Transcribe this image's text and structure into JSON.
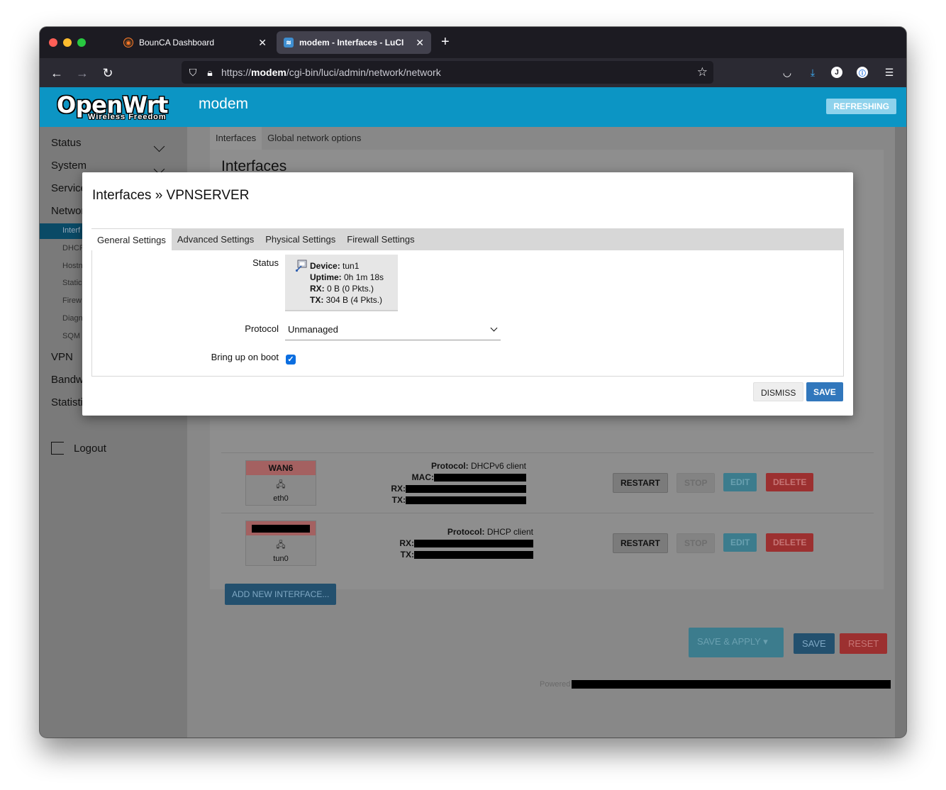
{
  "browser": {
    "tabs": [
      {
        "title": "BounCA Dashboard",
        "active": false
      },
      {
        "title": "modem - Interfaces - LuCI",
        "active": true
      }
    ],
    "url": {
      "scheme": "https://",
      "host": "modem",
      "path": "/cgi-bin/luci/admin/network/network"
    }
  },
  "header": {
    "logo": "OpenWrt",
    "logo_sub": "Wireless Freedom",
    "hostname": "modem",
    "refreshing": "REFRESHING"
  },
  "sidebar": {
    "items": [
      {
        "label": "Status"
      },
      {
        "label": "System"
      },
      {
        "label": "Service"
      },
      {
        "label": "Networ"
      },
      {
        "label": "VPN"
      },
      {
        "label": "Bandw"
      },
      {
        "label": "Statisti"
      }
    ],
    "sub_items": [
      {
        "label": "Interf"
      },
      {
        "label": "DHCP"
      },
      {
        "label": "Hostn"
      },
      {
        "label": "Static"
      },
      {
        "label": "Firew"
      },
      {
        "label": "Diagn"
      },
      {
        "label": "SQM"
      }
    ],
    "logout": "Logout"
  },
  "main": {
    "tabs": [
      "Interfaces",
      "Global network options"
    ],
    "title": "Interfaces",
    "rows": [
      {
        "name": "WAN6",
        "device": "eth0",
        "lines": [
          {
            "key": "Protocol:",
            "value": " DHCPv6 client"
          },
          {
            "key": "MAC:",
            "value": ""
          },
          {
            "key": "RX:",
            "value": ""
          },
          {
            "key": "TX:",
            "value": ""
          }
        ]
      },
      {
        "name": "",
        "device": "tun0",
        "lines": [
          {
            "key": "Protocol:",
            "value": " DHCP client"
          },
          {
            "key": "RX:",
            "value": ""
          },
          {
            "key": "TX:",
            "value": ""
          }
        ]
      }
    ],
    "row_buttons": {
      "restart": "RESTART",
      "stop": "STOP",
      "edit": "EDIT",
      "delete": "DELETE"
    },
    "add_interface": "ADD NEW INTERFACE...",
    "save_apply": "SAVE & APPLY",
    "save": "SAVE",
    "reset": "RESET",
    "powered": "Powered"
  },
  "modal": {
    "title": "Interfaces » VPNSERVER",
    "tabs": [
      "General Settings",
      "Advanced Settings",
      "Physical Settings",
      "Firewall Settings"
    ],
    "status_label": "Status",
    "status": {
      "device_key": "Device:",
      "device": " tun1",
      "uptime_key": "Uptime:",
      "uptime": " 0h 1m 18s",
      "rx_key": "RX:",
      "rx": " 0 B (0 Pkts.)",
      "tx_key": "TX:",
      "tx": " 304 B (4 Pkts.)"
    },
    "protocol_label": "Protocol",
    "protocol_value": "Unmanaged",
    "boot_label": "Bring up on boot",
    "boot_checked": true,
    "dismiss": "DISMISS",
    "save": "SAVE"
  }
}
